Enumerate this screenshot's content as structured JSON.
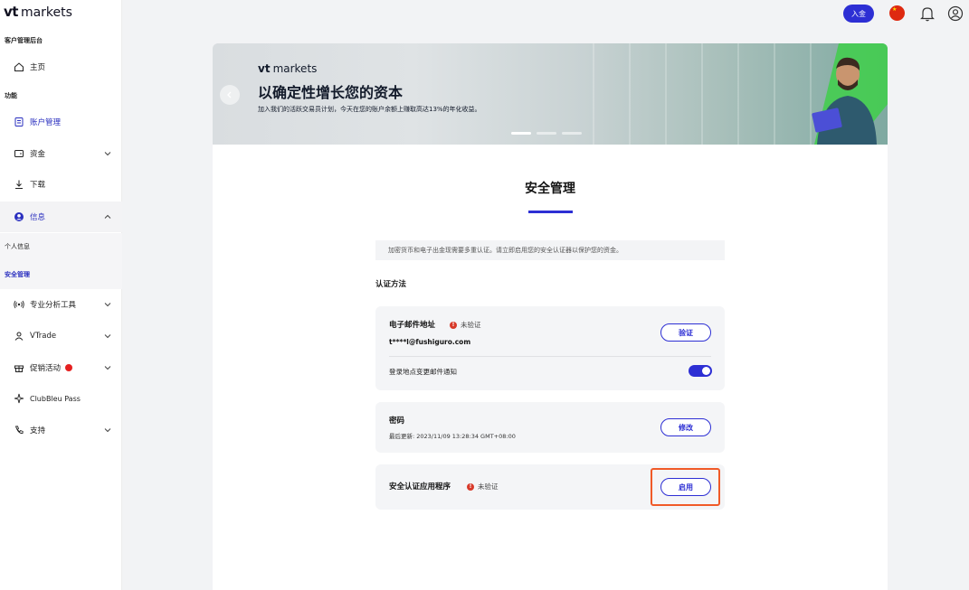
{
  "brand": {
    "vt": "vt",
    "markets": "markets"
  },
  "sidebar": {
    "section_client": "客户管理后台",
    "home": "主页",
    "section_functions": "功能",
    "items": [
      {
        "label": "账户管理"
      },
      {
        "label": "资金"
      },
      {
        "label": "下载"
      },
      {
        "label": "信息"
      },
      {
        "label": "个人信息"
      },
      {
        "label": "安全管理"
      },
      {
        "label": "专业分析工具"
      },
      {
        "label": "VTrade"
      },
      {
        "label": "促销活动"
      },
      {
        "label": "ClubBleu Pass"
      },
      {
        "label": "支持"
      }
    ]
  },
  "topbar": {
    "deposit_label": "入金",
    "flag_icon": "china-flag-icon",
    "colors": {
      "accent": "#2d2fd4"
    }
  },
  "banner": {
    "brand_vt": "vt",
    "brand_markets": "markets",
    "title": "以确定性增长您的资本",
    "subtitle": "加入我们的活跃交易员计划，今天在您的账户余额上赚取高达13%的年化收益。",
    "slide_count": 3,
    "active_slide": 1
  },
  "security": {
    "title": "安全管理",
    "notice": "加密货币和电子出金现需要多重认证。请立即启用您的安全认证器以保护您的资金。",
    "auth_methods_label": "认证方法",
    "email": {
      "title": "电子邮件地址",
      "status": "未验证",
      "value": "t****l@fushiguro.com",
      "button": "验证",
      "notify_label": "登录地点变更邮件通知",
      "notify_enabled": true
    },
    "password": {
      "title": "密码",
      "last_updated": "最后更新: 2023/11/09 13:28:34 GMT+08:00",
      "button": "修改"
    },
    "authenticator": {
      "title": "安全认证应用程序",
      "status": "未验证",
      "button": "启用"
    }
  }
}
